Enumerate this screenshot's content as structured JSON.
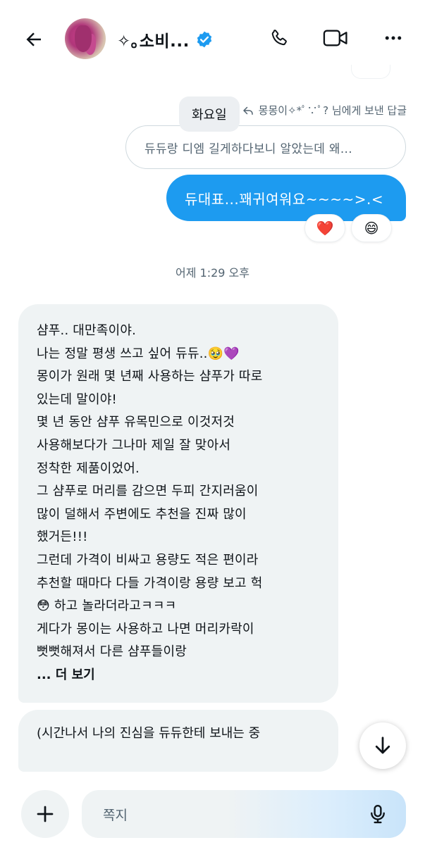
{
  "header": {
    "name": "✧｡소비...",
    "back_icon": "arrow-left-icon",
    "call_icon": "phone-icon",
    "video_icon": "video-camera-icon",
    "more_icon": "more-horizontal-icon",
    "verified_color": "#1d9bf0"
  },
  "conversation": {
    "date_pill": "화요일",
    "reply_label": "몽몽이✧*ﾟ∵ﾟ? 님에게 보낸 답글",
    "reply_quote": "듀듀랑 디엠 길게하다보니 알았는데 왜...",
    "sent_message": "듀대표...꽤귀여워요~~~~>.<",
    "reactions": [
      "❤️",
      "😄"
    ],
    "timestamp": "어제 1:29 오후",
    "received_lines": [
      "샴푸.. 대만족이야.",
      "나는 정말 평생 쓰고 싶어 듀듀..🥹💜",
      "몽이가 원래 몇 년째 사용하는 샴푸가 따로",
      "있는데 말이야!",
      "몇 년 동안 샴푸 유목민으로 이것저것",
      "사용해보다가 그나마 제일 잘 맞아서",
      "정착한 제품이었어.",
      "그 샴푸로 머리를 감으면 두피 간지러움이",
      "많이 덜해서 주변에도 추천을 진짜 많이",
      "했거든!!!",
      "그런데 가격이 비싸고 용량도 적은 편이라",
      "추천할 때마다 다들 가격이랑 용량 보고 헉",
      "😳 하고 놀라더라고ㅋㅋㅋ",
      "게다가 몽이는 사용하고 나면 머리카락이",
      "뻣뻣해져서 다른 샴푸들이랑"
    ],
    "more_label": "... 더 보기",
    "received_message_2": "(시간나서 나의 진심을 듀듀한테 보내는 중"
  },
  "composer": {
    "placeholder": "쪽지",
    "plus_icon": "plus-icon",
    "mic_icon": "microphone-icon",
    "scroll_down_icon": "arrow-down-icon"
  },
  "colors": {
    "accent": "#1d9bf0",
    "bubble_received": "#eff3f4",
    "secondary_text": "#536471"
  }
}
